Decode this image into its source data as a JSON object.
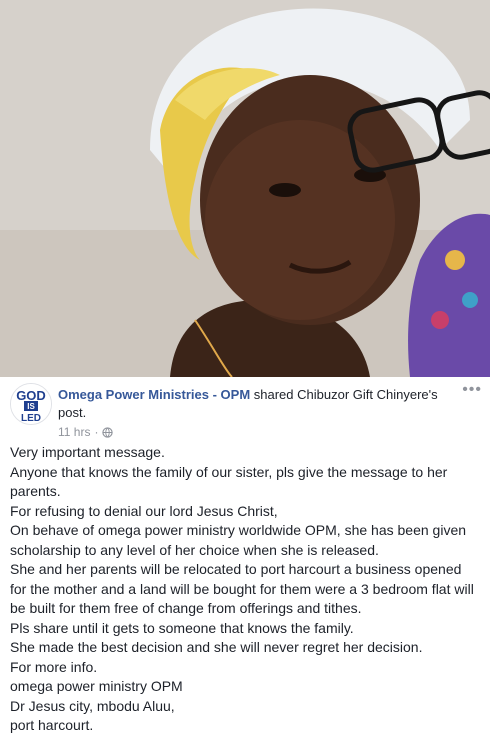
{
  "post": {
    "page_name": "Omega Power Ministries - OPM",
    "shared_text": " shared Chibuzor Gift Chinyere's post.",
    "time": "11 hrs",
    "privacy_icon": "globe-icon",
    "more_icon": "more-options-icon",
    "avatar_text": {
      "line1": "GOD",
      "line2": "IS",
      "line3": "LED"
    }
  },
  "body_lines": [
    "Very important message.",
    "Anyone that knows the family of our sister, pls give the message to her parents.",
    "For refusing to denial our lord Jesus Christ,",
    "On behave of omega power ministry worldwide OPM, she has been given scholarship to any level of her choice when she is released.",
    "She and her parents will be relocated to port harcourt a business opened for the mother and a land will be bought for them were a 3 bedroom flat will be built for them free of change from offerings and tithes.",
    "Pls share until it gets to someone that knows the family.",
    "She made the best decision and she will never regret her decision.",
    "For more info.",
    "omega power ministry OPM",
    "Dr Jesus city, mbodu Aluu,",
    "port harcourt."
  ]
}
